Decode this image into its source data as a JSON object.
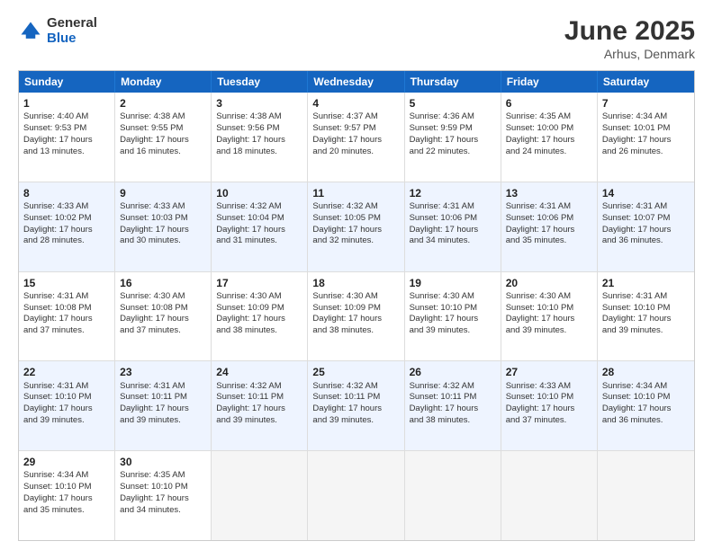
{
  "logo": {
    "general": "General",
    "blue": "Blue"
  },
  "title": "June 2025",
  "location": "Arhus, Denmark",
  "headers": [
    "Sunday",
    "Monday",
    "Tuesday",
    "Wednesday",
    "Thursday",
    "Friday",
    "Saturday"
  ],
  "rows": [
    [
      {
        "num": "",
        "data": ""
      },
      {
        "num": "2",
        "data": "Sunrise: 4:38 AM\nSunset: 9:55 PM\nDaylight: 17 hours\nand 16 minutes."
      },
      {
        "num": "3",
        "data": "Sunrise: 4:38 AM\nSunset: 9:56 PM\nDaylight: 17 hours\nand 18 minutes."
      },
      {
        "num": "4",
        "data": "Sunrise: 4:37 AM\nSunset: 9:57 PM\nDaylight: 17 hours\nand 20 minutes."
      },
      {
        "num": "5",
        "data": "Sunrise: 4:36 AM\nSunset: 9:59 PM\nDaylight: 17 hours\nand 22 minutes."
      },
      {
        "num": "6",
        "data": "Sunrise: 4:35 AM\nSunset: 10:00 PM\nDaylight: 17 hours\nand 24 minutes."
      },
      {
        "num": "7",
        "data": "Sunrise: 4:34 AM\nSunset: 10:01 PM\nDaylight: 17 hours\nand 26 minutes."
      }
    ],
    [
      {
        "num": "1",
        "data": "Sunrise: 4:40 AM\nSunset: 9:53 PM\nDaylight: 17 hours\nand 13 minutes."
      },
      {
        "num": "",
        "data": ""
      },
      {
        "num": "",
        "data": ""
      },
      {
        "num": "",
        "data": ""
      },
      {
        "num": "",
        "data": ""
      },
      {
        "num": "",
        "data": ""
      },
      {
        "num": "",
        "data": ""
      }
    ],
    [
      {
        "num": "8",
        "data": "Sunrise: 4:33 AM\nSunset: 10:02 PM\nDaylight: 17 hours\nand 28 minutes."
      },
      {
        "num": "9",
        "data": "Sunrise: 4:33 AM\nSunset: 10:03 PM\nDaylight: 17 hours\nand 30 minutes."
      },
      {
        "num": "10",
        "data": "Sunrise: 4:32 AM\nSunset: 10:04 PM\nDaylight: 17 hours\nand 31 minutes."
      },
      {
        "num": "11",
        "data": "Sunrise: 4:32 AM\nSunset: 10:05 PM\nDaylight: 17 hours\nand 32 minutes."
      },
      {
        "num": "12",
        "data": "Sunrise: 4:31 AM\nSunset: 10:06 PM\nDaylight: 17 hours\nand 34 minutes."
      },
      {
        "num": "13",
        "data": "Sunrise: 4:31 AM\nSunset: 10:06 PM\nDaylight: 17 hours\nand 35 minutes."
      },
      {
        "num": "14",
        "data": "Sunrise: 4:31 AM\nSunset: 10:07 PM\nDaylight: 17 hours\nand 36 minutes."
      }
    ],
    [
      {
        "num": "15",
        "data": "Sunrise: 4:31 AM\nSunset: 10:08 PM\nDaylight: 17 hours\nand 37 minutes."
      },
      {
        "num": "16",
        "data": "Sunrise: 4:30 AM\nSunset: 10:08 PM\nDaylight: 17 hours\nand 37 minutes."
      },
      {
        "num": "17",
        "data": "Sunrise: 4:30 AM\nSunset: 10:09 PM\nDaylight: 17 hours\nand 38 minutes."
      },
      {
        "num": "18",
        "data": "Sunrise: 4:30 AM\nSunset: 10:09 PM\nDaylight: 17 hours\nand 38 minutes."
      },
      {
        "num": "19",
        "data": "Sunrise: 4:30 AM\nSunset: 10:10 PM\nDaylight: 17 hours\nand 39 minutes."
      },
      {
        "num": "20",
        "data": "Sunrise: 4:30 AM\nSunset: 10:10 PM\nDaylight: 17 hours\nand 39 minutes."
      },
      {
        "num": "21",
        "data": "Sunrise: 4:31 AM\nSunset: 10:10 PM\nDaylight: 17 hours\nand 39 minutes."
      }
    ],
    [
      {
        "num": "22",
        "data": "Sunrise: 4:31 AM\nSunset: 10:10 PM\nDaylight: 17 hours\nand 39 minutes."
      },
      {
        "num": "23",
        "data": "Sunrise: 4:31 AM\nSunset: 10:11 PM\nDaylight: 17 hours\nand 39 minutes."
      },
      {
        "num": "24",
        "data": "Sunrise: 4:32 AM\nSunset: 10:11 PM\nDaylight: 17 hours\nand 39 minutes."
      },
      {
        "num": "25",
        "data": "Sunrise: 4:32 AM\nSunset: 10:11 PM\nDaylight: 17 hours\nand 39 minutes."
      },
      {
        "num": "26",
        "data": "Sunrise: 4:32 AM\nSunset: 10:11 PM\nDaylight: 17 hours\nand 38 minutes."
      },
      {
        "num": "27",
        "data": "Sunrise: 4:33 AM\nSunset: 10:10 PM\nDaylight: 17 hours\nand 37 minutes."
      },
      {
        "num": "28",
        "data": "Sunrise: 4:34 AM\nSunset: 10:10 PM\nDaylight: 17 hours\nand 36 minutes."
      }
    ],
    [
      {
        "num": "29",
        "data": "Sunrise: 4:34 AM\nSunset: 10:10 PM\nDaylight: 17 hours\nand 35 minutes."
      },
      {
        "num": "30",
        "data": "Sunrise: 4:35 AM\nSunset: 10:10 PM\nDaylight: 17 hours\nand 34 minutes."
      },
      {
        "num": "",
        "data": ""
      },
      {
        "num": "",
        "data": ""
      },
      {
        "num": "",
        "data": ""
      },
      {
        "num": "",
        "data": ""
      },
      {
        "num": "",
        "data": ""
      }
    ]
  ]
}
